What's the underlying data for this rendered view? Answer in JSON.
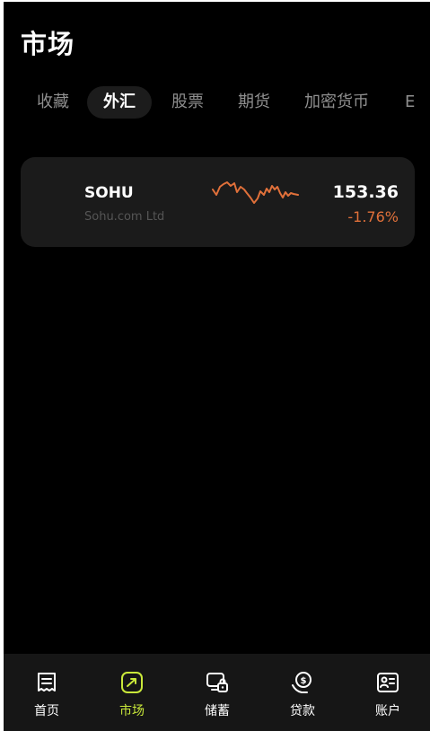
{
  "header": {
    "title": "市场"
  },
  "tabs": [
    {
      "label": "收藏"
    },
    {
      "label": "外汇",
      "active": true
    },
    {
      "label": "股票"
    },
    {
      "label": "期货"
    },
    {
      "label": "加密货币"
    },
    {
      "label": "E"
    }
  ],
  "market_list": [
    {
      "symbol": "SOHU",
      "name": "Sohu.com Ltd",
      "price": "153.36",
      "change": "-1.76%",
      "trend_color": "#e0703a"
    }
  ],
  "bottom_nav": {
    "active_color": "#c9e83a",
    "items": [
      {
        "label": "首页",
        "icon": "receipt-icon"
      },
      {
        "label": "市场",
        "icon": "trend-chart-icon",
        "active": true
      },
      {
        "label": "储蓄",
        "icon": "savings-lock-icon"
      },
      {
        "label": "贷款",
        "icon": "coin-hand-icon"
      },
      {
        "label": "账户",
        "icon": "id-card-icon"
      }
    ]
  }
}
